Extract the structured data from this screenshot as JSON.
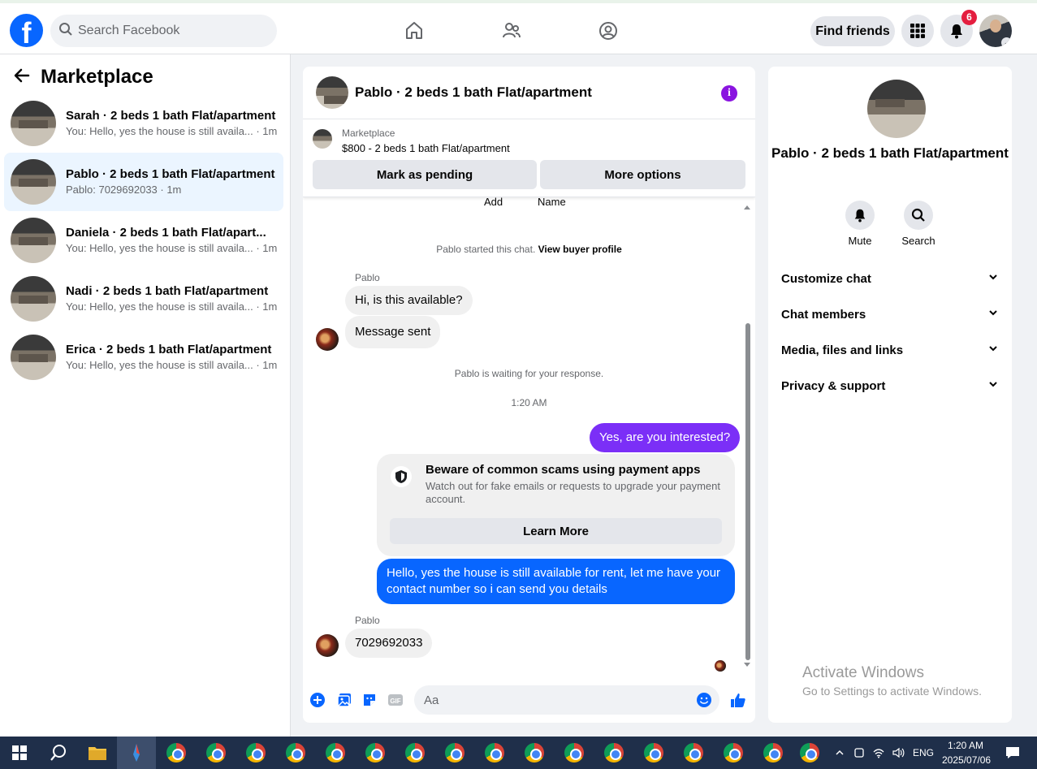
{
  "topbar": {
    "search_placeholder": "Search Facebook",
    "find_friends": "Find friends",
    "notification_count": "6"
  },
  "sidebar": {
    "title": "Marketplace",
    "conversations": [
      {
        "name": "Sarah · 2 beds 1 bath Flat/apartment",
        "preview": "You: Hello, yes the house is still availa... · 1m"
      },
      {
        "name": "Pablo · 2 beds 1 bath Flat/apartment",
        "preview": "Pablo: 7029692033 · 1m",
        "active": true
      },
      {
        "name": "Daniela · 2 beds 1 bath Flat/apart...",
        "preview": "You: Hello, yes the house is still availa... · 1m"
      },
      {
        "name": "Nadi · 2 beds 1 bath Flat/apartment",
        "preview": "You: Hello, yes the house is still availa... · 1m"
      },
      {
        "name": "Erica · 2 beds 1 bath Flat/apartment",
        "preview": "You: Hello, yes the house is still availa... · 1m"
      }
    ]
  },
  "chat": {
    "title": "Pablo · 2 beds 1 bath Flat/apartment",
    "marketplace_label": "Marketplace",
    "listing": "$800 - 2 beds 1 bath Flat/apartment",
    "mark_pending": "Mark as pending",
    "more_options": "More options",
    "cut_add": "Add",
    "cut_name": "Name",
    "started_text": "Pablo started this chat.",
    "view_profile": "View buyer profile",
    "sender_name": "Pablo",
    "msg_available": "Hi, is this available?",
    "msg_sent": "Message sent",
    "waiting": "Pablo is waiting for your response.",
    "time": "1:20 AM",
    "msg_interested": "Yes, are you interested?",
    "scam_title": "Beware of common scams using payment apps",
    "scam_body": "Watch out for fake emails or requests to upgrade your payment account.",
    "learn_more": "Learn More",
    "msg_reply": "Hello, yes the house is still available for rent, let me have your contact number so i can send you details",
    "msg_number": "7029692033",
    "input_placeholder": "Aa"
  },
  "details": {
    "title": "Pablo · 2 beds 1 bath Flat/apartment",
    "mute": "Mute",
    "search": "Search",
    "sections": [
      "Customize chat",
      "Chat members",
      "Media, files and links",
      "Privacy & support"
    ]
  },
  "watermark": {
    "line1": "Activate Windows",
    "line2": "Go to Settings to activate Windows."
  },
  "taskbar": {
    "lang": "ENG",
    "time": "1:20 AM",
    "date": "2025/07/06"
  },
  "colors": {
    "brand": "#0866ff",
    "outgoing_primary": "#0866ff",
    "outgoing_accent": "#7b2ff7",
    "info": "#8a14e0",
    "badge": "#e41e3f"
  }
}
